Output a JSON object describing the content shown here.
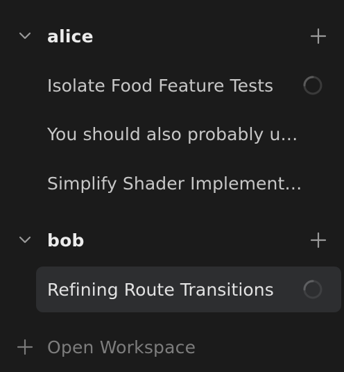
{
  "sidebar": {
    "groups": [
      {
        "name": "alice",
        "expanded": true,
        "icons": {
          "toggle": "chevron-down-icon",
          "add": "plus-icon"
        },
        "items": [
          {
            "label": "Isolate Food Feature Tests",
            "status": "loading"
          },
          {
            "label": "You should also probably u…"
          },
          {
            "label": "Simplify Shader Implement…"
          }
        ]
      },
      {
        "name": "bob",
        "expanded": true,
        "icons": {
          "toggle": "chevron-down-icon",
          "add": "plus-icon"
        },
        "items": [
          {
            "label": "Refining Route Transitions",
            "status": "loading",
            "selected": true
          }
        ]
      }
    ],
    "open_workspace": {
      "label": "Open Workspace",
      "icon": "plus-icon"
    }
  },
  "colors": {
    "background": "#1b1b1b",
    "selected_background": "#2d2e30",
    "text_primary": "#ececec",
    "text_secondary": "#c7c7c7",
    "text_muted": "#7d7d7d",
    "icon": "#9a9a9a"
  }
}
